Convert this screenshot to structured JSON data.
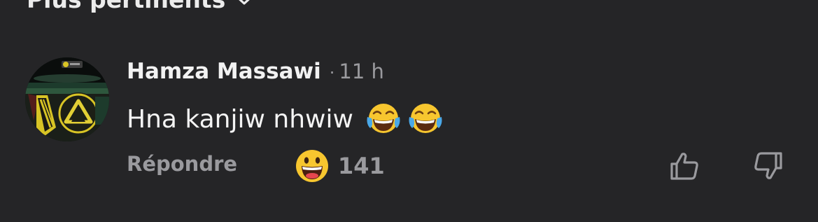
{
  "sort": {
    "label": "Plus pertinents",
    "icon": "chevron-down-icon"
  },
  "comment": {
    "author": "Hamza Massawi",
    "separator": "·",
    "time": "11 h",
    "text": "Hna kanjiw nhwiw",
    "emojis": [
      "tears-of-joy-emoji",
      "tears-of-joy-emoji"
    ]
  },
  "actions": {
    "reply_label": "Répondre",
    "reaction_icon": "grinning-face-emoji",
    "reaction_count": "141",
    "like_icon": "thumbs-up-icon",
    "dislike_icon": "thumbs-down-icon"
  },
  "colors": {
    "background": "#252527",
    "primary_text": "#f2f2f2",
    "secondary_text": "#9a9a9e",
    "emoji_yellow": "#f7c62f"
  }
}
